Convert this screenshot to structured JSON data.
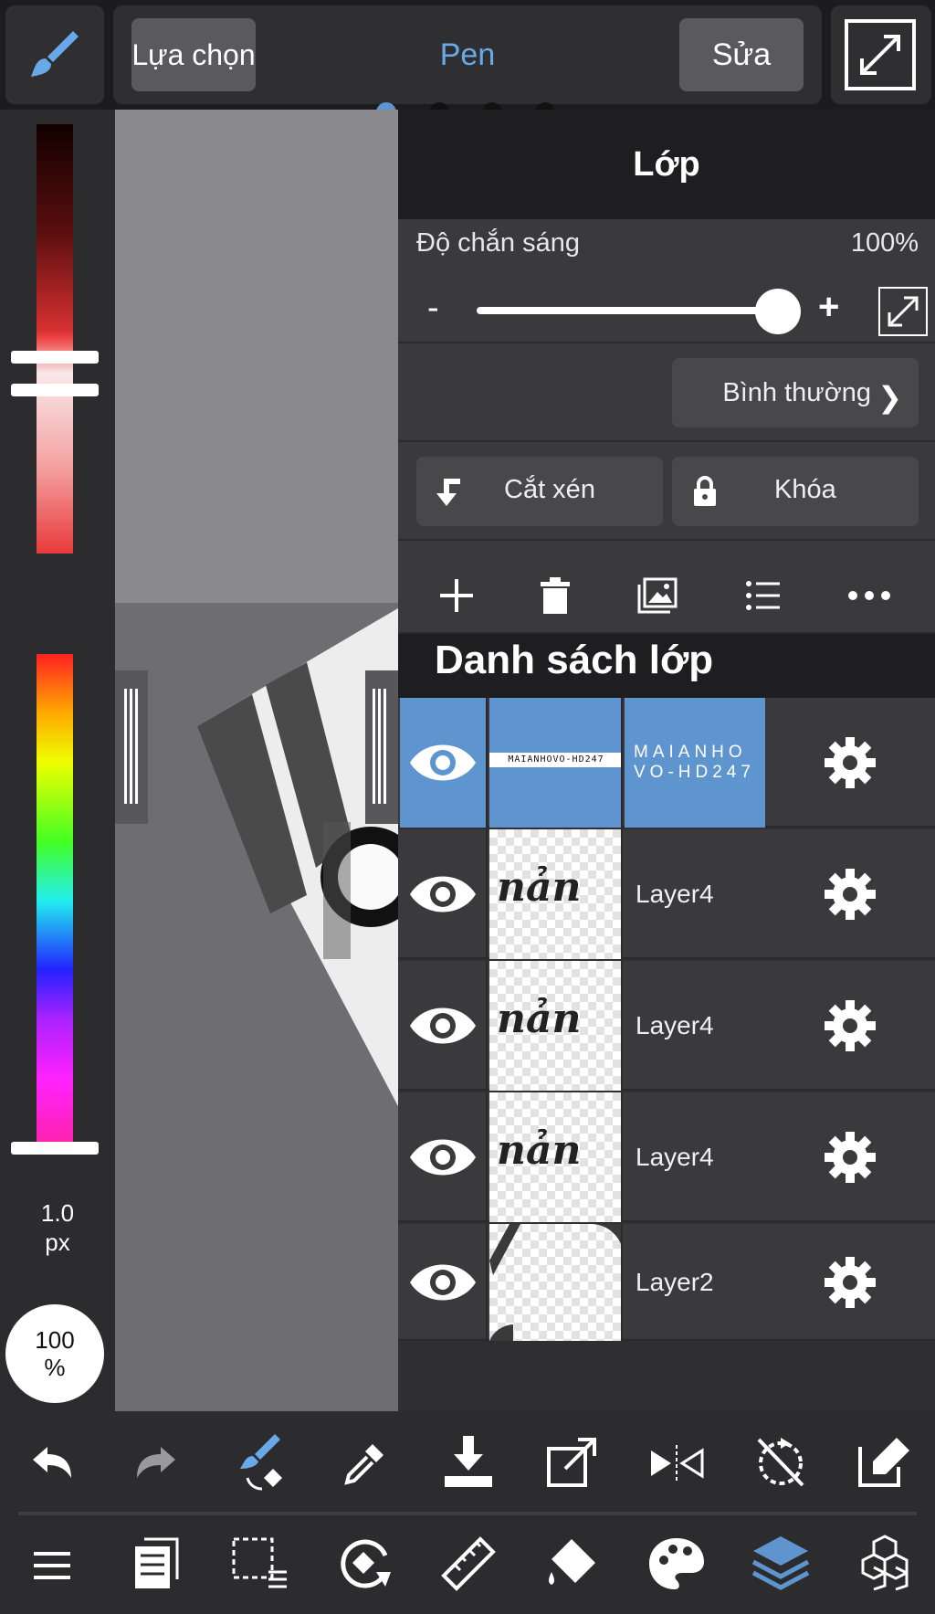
{
  "top_bar": {
    "select_label": "Lựa chọn",
    "tool_name": "Pen",
    "edit_label": "Sửa"
  },
  "color_panel": {
    "brush_size_value": "1.0",
    "brush_size_unit": "px",
    "opacity_value": "100",
    "opacity_unit": "%"
  },
  "layers_panel": {
    "title": "Lớp",
    "opacity_label": "Độ chắn sáng",
    "opacity_value": "100%",
    "opacity_fraction": 1.0,
    "blend_mode": "Bình thường",
    "clip_label": "Cắt xén",
    "lock_label": "Khóa",
    "list_title": "Danh sách lớp",
    "layers": [
      {
        "name": "MAIANHO VO-HD247",
        "thumb_text": "MAIANHOVO-HD247",
        "selected": true
      },
      {
        "name": "Layer4",
        "thumb_text": "nản",
        "selected": false
      },
      {
        "name": "Layer4",
        "thumb_text": "nản",
        "selected": false
      },
      {
        "name": "Layer4",
        "thumb_text": "nản",
        "selected": false
      },
      {
        "name": "Layer2",
        "thumb_text": "",
        "selected": false
      }
    ]
  },
  "colors": {
    "accent": "#6aa9e9",
    "selected_layer": "#5f95cf",
    "panel_bg": "#2f2f31"
  },
  "icons": {
    "top": [
      "brush-icon",
      "expand-icon"
    ],
    "layer_tools": [
      "add-layer-icon",
      "delete-layer-icon",
      "image-layer-icon",
      "list-icon",
      "more-icon"
    ],
    "bottom_row1": [
      "undo-icon",
      "redo-icon",
      "brush-swap-icon",
      "eyedropper-icon",
      "download-icon",
      "transform-icon",
      "flip-icon",
      "rotate-lock-icon",
      "edit-canvas-icon"
    ],
    "bottom_row2": [
      "menu-icon",
      "pages-icon",
      "selection-icon",
      "rotate-view-icon",
      "ruler-icon",
      "fill-icon",
      "palette-icon",
      "layers-icon",
      "materials-icon"
    ]
  }
}
